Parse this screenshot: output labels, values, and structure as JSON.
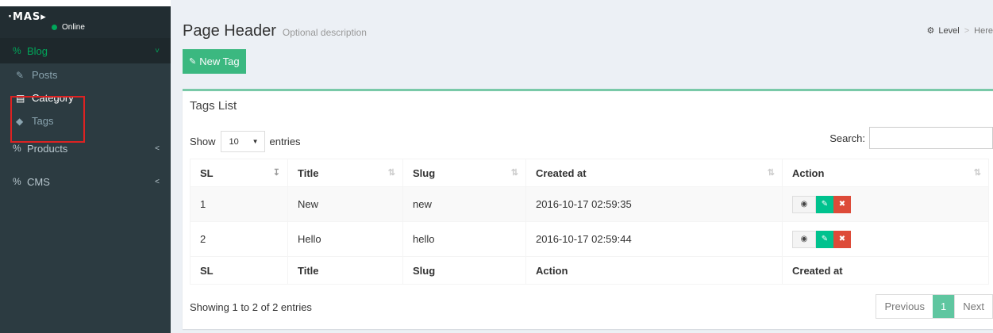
{
  "sidebar": {
    "logo": "·MAS▸",
    "status": "Online",
    "items": [
      {
        "label": "Blog",
        "icon": "percent-icon",
        "chevron": "˅"
      },
      {
        "label": "Products",
        "icon": "percent-icon",
        "chevron": "<"
      },
      {
        "label": "CMS",
        "icon": "percent-icon",
        "chevron": "<"
      }
    ],
    "sub_items": [
      {
        "label": "Posts",
        "icon": "posts-icon"
      },
      {
        "label": "Category",
        "icon": "file-icon"
      },
      {
        "label": "Tags",
        "icon": "tag-icon"
      }
    ]
  },
  "header": {
    "title": "Page Header",
    "description": "Optional description",
    "breadcrumb_level": "Level",
    "breadcrumb_here": "Here"
  },
  "toolbar": {
    "new_tag_label": "New Tag"
  },
  "box": {
    "title": "Tags List",
    "show_label": "Show",
    "entries_value": "10",
    "entries_label": "entries",
    "search_label": "Search:",
    "search_value": ""
  },
  "table": {
    "headers": [
      "SL",
      "Title",
      "Slug",
      "Created at",
      "Action"
    ],
    "rows": [
      {
        "sl": "1",
        "title": "New",
        "slug": "new",
        "created": "2016-10-17 02:59:35"
      },
      {
        "sl": "2",
        "title": "Hello",
        "slug": "hello",
        "created": "2016-10-17 02:59:44"
      }
    ],
    "footers": [
      "SL",
      "Title",
      "Slug",
      "Action",
      "Created at"
    ]
  },
  "footer": {
    "info": "Showing 1 to 2 of 2 entries",
    "previous": "Previous",
    "current_page": "1",
    "next": "Next"
  },
  "colors": {
    "accent": "#00a65a",
    "sidebar": "#2c3b41",
    "danger": "#dd4b39",
    "highlight": "#dd2222"
  }
}
